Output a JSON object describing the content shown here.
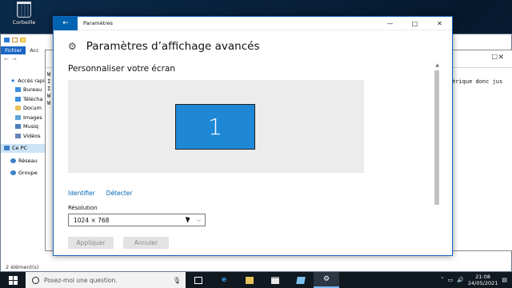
{
  "desktop": {
    "recycle_bin_label": "Corbeille"
  },
  "explorer": {
    "ribbon_file": "Fichier",
    "ribbon_access": "Acc",
    "nav_items": [
      {
        "label": "Accès rapide",
        "icon": "star-icon"
      },
      {
        "label": "Bureau",
        "icon": "desktop-folder-icon"
      },
      {
        "label": "Télécha",
        "icon": "downloads-folder-icon"
      },
      {
        "label": "Docum",
        "icon": "documents-folder-icon"
      },
      {
        "label": "Images",
        "icon": "pictures-folder-icon"
      },
      {
        "label": "Musiq",
        "icon": "music-folder-icon"
      },
      {
        "label": "Vidéos",
        "icon": "videos-folder-icon"
      },
      {
        "label": "Ce PC",
        "icon": "this-pc-icon"
      },
      {
        "label": "Réseau",
        "icon": "network-icon"
      },
      {
        "label": "Groupe",
        "icon": "homegroup-icon"
      }
    ],
    "status": "2 élément(s)"
  },
  "notepad": {
    "lines": [
      "W",
      "I",
      "I",
      "W",
      "W"
    ],
    "right_text": "érique donc jus"
  },
  "settings": {
    "window_title": "Paramètres",
    "page_title": "Paramètres d’affichage avancés",
    "section_title": "Personnaliser votre écran",
    "monitor_number": "1",
    "link_identify": "Identifier",
    "link_detect": "Détecter",
    "resolution_label": "Résolution",
    "resolution_value": "1024 × 768",
    "apply_label": "Appliquer",
    "cancel_label": "Annuler",
    "accent_color": "#0063b1",
    "monitor_color": "#1e88d6"
  },
  "taskbar": {
    "search_placeholder": "Posez-moi une question.",
    "time": "21:08",
    "date": "24/05/2021"
  }
}
